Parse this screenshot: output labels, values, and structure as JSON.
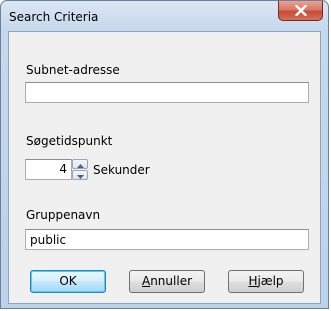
{
  "window": {
    "title": "Search Criteria"
  },
  "subnet": {
    "label": "Subnet-adresse",
    "value": ""
  },
  "timeout": {
    "label": "Søgetidspunkt",
    "value": "4",
    "unit": "Sekunder"
  },
  "group": {
    "label": "Gruppenavn",
    "value": "public"
  },
  "buttons": {
    "ok": "OK",
    "cancel_prefix": "",
    "cancel_mnemonic": "A",
    "cancel_rest": "nnuller",
    "help_prefix": "",
    "help_mnemonic": "H",
    "help_rest": "jælp"
  },
  "icons": {
    "close": "close-icon",
    "spin_up": "arrow-up-icon",
    "spin_down": "arrow-down-icon"
  },
  "colors": {
    "close_button": "#c94a36",
    "default_button_border": "#3c7fb1",
    "window_frame": "#bcd2ea",
    "client_background": "#f0f0f0"
  }
}
